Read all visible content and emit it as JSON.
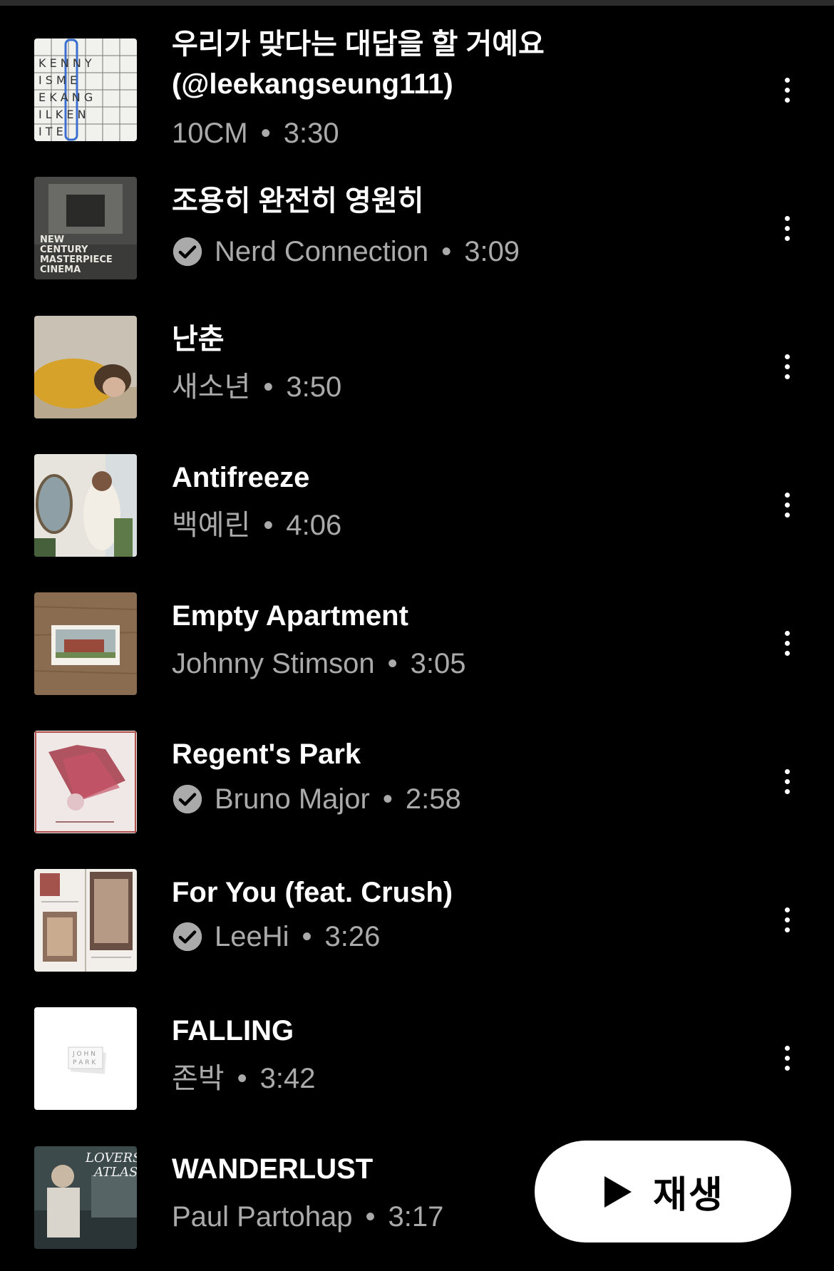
{
  "tracks": [
    {
      "title": "우리가 맞다는 대답을 할 거예요 (@leekangseung111)",
      "artist": "10CM",
      "verified": false,
      "duration": "3:30",
      "art": "crossword-art"
    },
    {
      "title": "조용히 완전히 영원히",
      "artist": "Nerd Connection",
      "verified": true,
      "duration": "3:09",
      "art": "cinema-art",
      "art_text": "NEW CENTURY MASTERPIECE CINEMA"
    },
    {
      "title": "난춘",
      "artist": "새소년",
      "verified": false,
      "duration": "3:50",
      "art": "yellow-sweater-art"
    },
    {
      "title": "Antifreeze",
      "artist": "백예린",
      "verified": false,
      "duration": "4:06",
      "art": "mirror-art"
    },
    {
      "title": "Empty Apartment",
      "artist": "Johnny Stimson",
      "verified": false,
      "duration": "3:05",
      "art": "photo-on-wood-art"
    },
    {
      "title": "Regent's Park",
      "artist": "Bruno Major",
      "verified": true,
      "duration": "2:58",
      "art": "red-fan-art"
    },
    {
      "title": "For You (feat. Crush)",
      "artist": "LeeHi",
      "verified": true,
      "duration": "3:26",
      "art": "scrapbook-art"
    },
    {
      "title": "FALLING",
      "artist": "존박",
      "verified": false,
      "duration": "3:42",
      "art": "john-park-art",
      "art_text": "JOHN PARK"
    },
    {
      "title": "WANDERLUST",
      "artist": "Paul Partohap",
      "verified": false,
      "duration": "3:17",
      "art": "lovers-atlas-art",
      "art_text": "LOVERS ATLAS"
    }
  ],
  "separator": "•",
  "play_button": {
    "label": "재생",
    "icon": "play-icon"
  },
  "more_icon": "more-vert-icon",
  "verified_icon": "verified-check-icon",
  "colors": {
    "background": "#000000",
    "title": "#ffffff",
    "subtitle": "#aaaaaa",
    "play_button_bg": "#ffffff"
  }
}
